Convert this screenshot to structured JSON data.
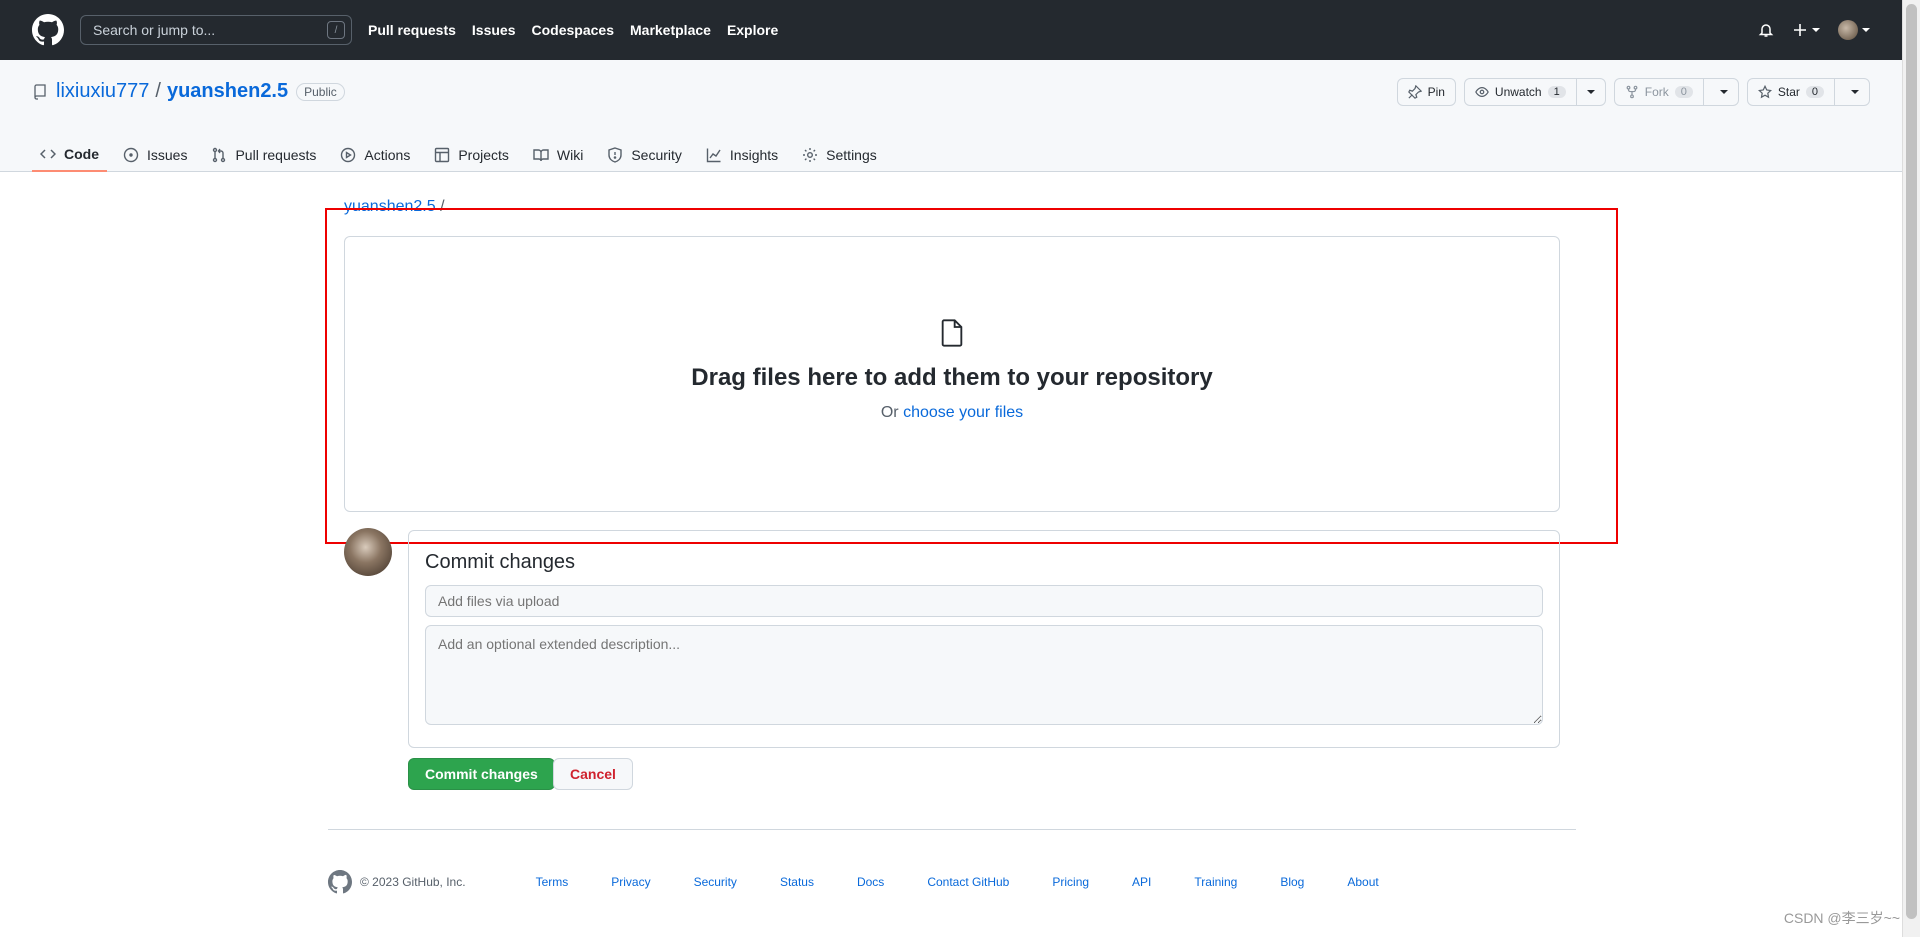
{
  "header": {
    "search_placeholder": "Search or jump to...",
    "search_shortcut": "/",
    "nav": [
      "Pull requests",
      "Issues",
      "Codespaces",
      "Marketplace",
      "Explore"
    ]
  },
  "repo": {
    "owner": "lixiuxiu777",
    "separator": "/",
    "name": "yuanshen2.5",
    "visibility": "Public",
    "actions": {
      "pin": "Pin",
      "unwatch": "Unwatch",
      "watch_count": "1",
      "fork": "Fork",
      "fork_count": "0",
      "star": "Star",
      "star_count": "0"
    },
    "tabs": [
      "Code",
      "Issues",
      "Pull requests",
      "Actions",
      "Projects",
      "Wiki",
      "Security",
      "Insights",
      "Settings"
    ]
  },
  "upload": {
    "breadcrumb_repo": "yuanshen2.5",
    "breadcrumb_sep": "/",
    "drop_title": "Drag files here to add them to your repository",
    "drop_or": "Or",
    "choose_link": "choose your files"
  },
  "commit": {
    "title": "Commit changes",
    "summary_placeholder": "Add files via upload",
    "description_placeholder": "Add an optional extended description...",
    "commit_button": "Commit changes",
    "cancel_button": "Cancel"
  },
  "footer": {
    "copyright": "© 2023 GitHub, Inc.",
    "links": [
      "Terms",
      "Privacy",
      "Security",
      "Status",
      "Docs",
      "Contact GitHub",
      "Pricing",
      "API",
      "Training",
      "Blog",
      "About"
    ]
  },
  "watermark": "CSDN @李三岁~~",
  "colors": {
    "header_bg": "#24292f",
    "link": "#0969da",
    "primary_button": "#2da44e",
    "danger": "#cf222e",
    "annotation_box": "#ee0000"
  }
}
